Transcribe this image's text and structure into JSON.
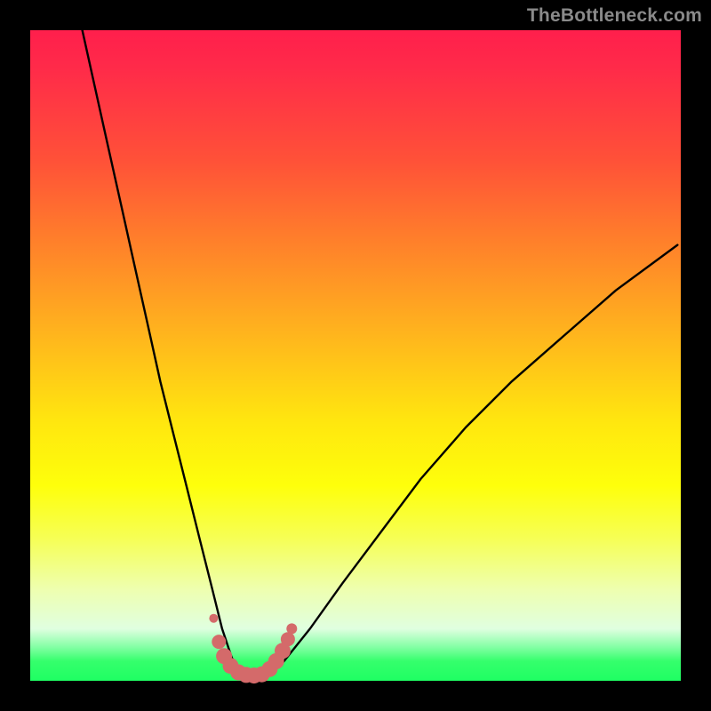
{
  "watermark": {
    "text": "TheBottleneck.com"
  },
  "chart_data": {
    "type": "line",
    "title": "",
    "xlabel": "",
    "ylabel": "",
    "xlim": [
      0,
      100
    ],
    "ylim": [
      0,
      100
    ],
    "series": [
      {
        "name": "bottleneck-curve",
        "x": [
          8,
          10,
          12,
          14,
          16,
          18,
          20,
          22,
          24,
          26,
          28,
          29.5,
          31,
          33,
          35,
          37,
          39,
          43,
          48,
          54,
          60,
          67,
          74,
          82,
          90,
          99.5
        ],
        "y": [
          100,
          91,
          82,
          73,
          64,
          55,
          46,
          38,
          30,
          22,
          14,
          8,
          3.5,
          1,
          0.5,
          1,
          3,
          8,
          15,
          23,
          31,
          39,
          46,
          53,
          60,
          67
        ]
      }
    ],
    "markers": {
      "name": "optimum-band",
      "color": "#d46a6a",
      "points": [
        {
          "x": 28.2,
          "y": 9.6,
          "r": 5
        },
        {
          "x": 29.0,
          "y": 6.0,
          "r": 8
        },
        {
          "x": 29.8,
          "y": 3.8,
          "r": 9
        },
        {
          "x": 30.8,
          "y": 2.3,
          "r": 9
        },
        {
          "x": 32.0,
          "y": 1.3,
          "r": 9
        },
        {
          "x": 33.2,
          "y": 0.9,
          "r": 9
        },
        {
          "x": 34.4,
          "y": 0.8,
          "r": 9
        },
        {
          "x": 35.6,
          "y": 1.0,
          "r": 9
        },
        {
          "x": 36.8,
          "y": 1.8,
          "r": 9
        },
        {
          "x": 37.8,
          "y": 3.0,
          "r": 9
        },
        {
          "x": 38.8,
          "y": 4.6,
          "r": 9
        },
        {
          "x": 39.6,
          "y": 6.4,
          "r": 8
        },
        {
          "x": 40.2,
          "y": 8.0,
          "r": 6
        }
      ]
    }
  }
}
